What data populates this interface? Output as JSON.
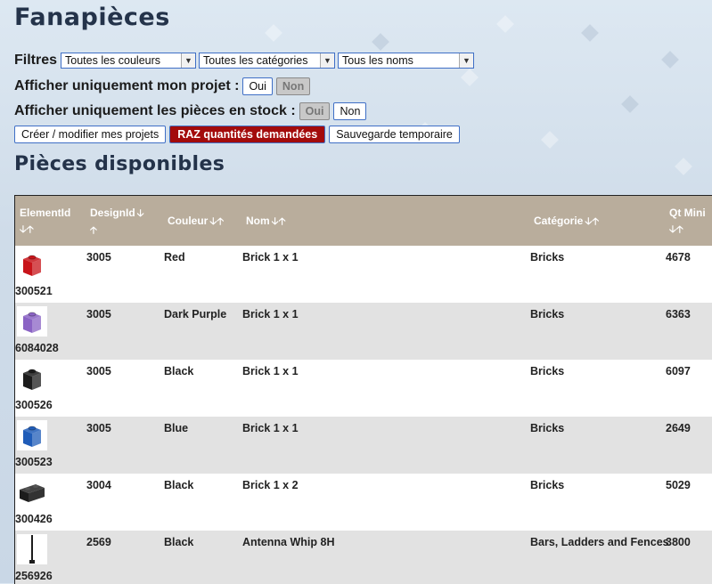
{
  "site_title": "Fanapièces",
  "filters": {
    "label": "Filtres",
    "color_select": "Toutes les couleurs",
    "category_select": "Toutes les catégories",
    "name_select": "Tous les noms"
  },
  "project_toggle": {
    "label": "Afficher uniquement mon projet :",
    "yes": "Oui",
    "no": "Non",
    "selected": "Non"
  },
  "stock_toggle": {
    "label": "Afficher uniquement les pièces en stock :",
    "yes": "Oui",
    "no": "Non",
    "selected": "Oui"
  },
  "actions": {
    "projects": "Créer / modifier mes projets",
    "reset": "RAZ quantités demandées",
    "save": "Sauvegarde temporaire"
  },
  "section_title": "Pièces disponibles",
  "table": {
    "columns": [
      "ElementId",
      "DesignId",
      "Couleur",
      "Nom",
      "Catégorie",
      "Qt Mini"
    ],
    "rows": [
      {
        "element_id": "300521",
        "design_id": "3005",
        "color": "Red",
        "name": "Brick 1 x 1",
        "category": "Bricks",
        "qty": "4678",
        "swatch": "#c8141a"
      },
      {
        "element_id": "6084028",
        "design_id": "3005",
        "color": "Dark Purple",
        "name": "Brick 1 x 1",
        "category": "Bricks",
        "qty": "6363",
        "swatch": "#8a63c4"
      },
      {
        "element_id": "300526",
        "design_id": "3005",
        "color": "Black",
        "name": "Brick 1 x 1",
        "category": "Bricks",
        "qty": "6097",
        "swatch": "#1c1c1c"
      },
      {
        "element_id": "300523",
        "design_id": "3005",
        "color": "Blue",
        "name": "Brick 1 x 1",
        "category": "Bricks",
        "qty": "2649",
        "swatch": "#1f5cb8"
      },
      {
        "element_id": "300426",
        "design_id": "3004",
        "color": "Black",
        "name": "Brick 1 x 2",
        "category": "Bricks",
        "qty": "5029",
        "swatch": "#1c1c1c"
      },
      {
        "element_id": "256926",
        "design_id": "2569",
        "color": "Black",
        "name": "Antenna Whip 8H",
        "category": "Bars, Ladders and Fences",
        "qty": "3800",
        "swatch": "#1c1c1c"
      }
    ]
  }
}
